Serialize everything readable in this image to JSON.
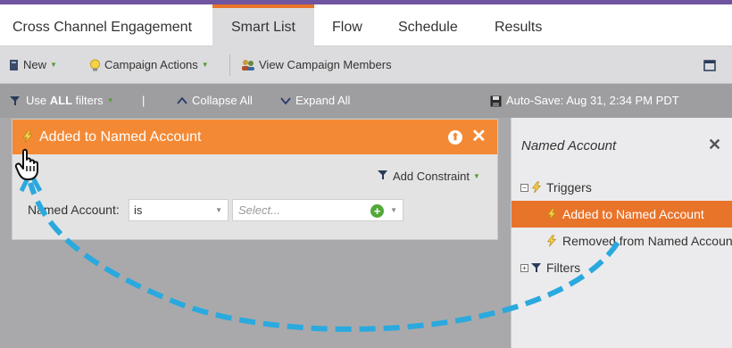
{
  "tabs": [
    {
      "label": "Cross Channel Engagement"
    },
    {
      "label": "Smart List"
    },
    {
      "label": "Flow"
    },
    {
      "label": "Schedule"
    },
    {
      "label": "Results"
    }
  ],
  "toolbar": {
    "new_label": "New",
    "campaign_actions_label": "Campaign Actions",
    "view_members_label": "View Campaign Members"
  },
  "filterbar": {
    "use_prefix": "Use ",
    "use_all": "ALL",
    "use_suffix": " filters",
    "pipe": "|",
    "collapse_label": "Collapse All",
    "expand_label": "Expand All",
    "autosave_label": "Auto-Save: Aug 31, 2:34 PM PDT"
  },
  "card": {
    "title": "Added to Named Account",
    "add_constraint_label": "Add Constraint",
    "field_label": "Named Account:",
    "operator_value": "is",
    "value_placeholder": "Select..."
  },
  "panel": {
    "title": "Named Account",
    "triggers_label": "Triggers",
    "items": [
      {
        "label": "Added to Named Account"
      },
      {
        "label": "Removed from Named Account"
      }
    ],
    "filters_label": "Filters"
  },
  "colors": {
    "accent": "#e8742a",
    "header_orange": "#f48935",
    "arrow": "#2aa9de"
  }
}
